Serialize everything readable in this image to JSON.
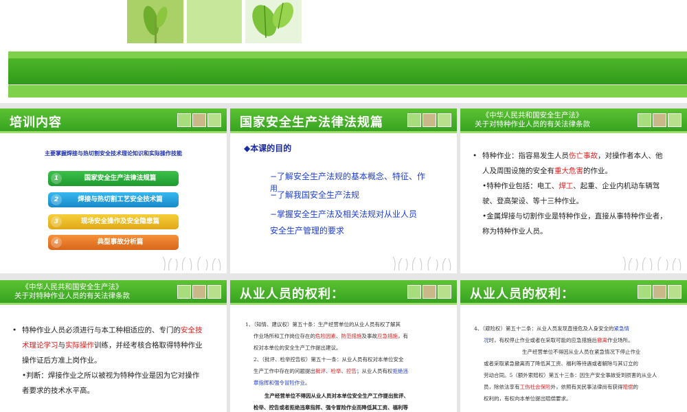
{
  "slides": {
    "s1": {
      "title": "培训内容",
      "subtitle": "主要掌握焊接与热切割安全技术理论知识和实际操作技能",
      "items": [
        {
          "num": "1",
          "label": "国家安全生产法律法规篇"
        },
        {
          "num": "2",
          "label": "焊接与热切割工艺安全技术篇"
        },
        {
          "num": "3",
          "label": "现场安全操作及安全隐患篇"
        },
        {
          "num": "4",
          "label": "典型事故分析篇"
        }
      ]
    },
    "s2": {
      "title": "国家安全生产法律法规篇",
      "purpose": "◆本课的目的",
      "line1": "−了解安全生产法规的基本概念、特征、作",
      "line1b": "用",
      "line2": "−了解我国安全生产法规",
      "line3": "−掌握安全生产法及相关法规对从业人员",
      "line3b": "安全生产管理的要求"
    },
    "s3": {
      "title_line1": "《中华人民共和国安全生产法》",
      "title_line2": "关于对特种作业人员的有关法律条款",
      "p1_a": "特种作业：指容易发生人员",
      "p1_red1": "伤亡事故",
      "p1_b": "，对操作者本人、他",
      "p1_c": "人及周围设施的安全有",
      "p1_red2": "重大危害",
      "p1_d": "的作业。",
      "p2_a": "•特种作业包括：电工、",
      "p2_red": "焊工",
      "p2_b": "、起重、企业内机动车辆驾",
      "p2_c": "驶、登高架设、等十三种作业。",
      "p3_a": "•金属焊接与切割作业是特种作业，直接从事特种作业者，",
      "p3_b": "称为特种作业人员。"
    },
    "s4": {
      "title_line1": "《中华人民共和国安全生产法》",
      "title_line2": "关于对特种作业人员的有关法律条款",
      "p1_a": "特种作业人员必须进行与本工种相适应的、专门的",
      "p1_red1": "安全技",
      "p1_red2": "术理论学习",
      "p1_b": "与",
      "p1_red3": "实际操作",
      "p1_c": "训练，并经考核合格取得特种作业",
      "p1_d": "操作证后方准上岗作业。",
      "p2_a": "•判断：焊接作业之所以被视为特种作业是因为它对操作",
      "p2_b": "者要求的技术水平高。"
    },
    "s5": {
      "title": "从业人员的权利：",
      "l1_a": "1、（知情、建议权）第五十条：生产经营单位的从业人员有权了解其",
      "l1_b": "作业场所和工作岗位存在的",
      "l1_red1": "危险因素",
      "l1_c": "、",
      "l1_red2": "防范措施",
      "l1_d": "及事故",
      "l1_red3": "应急措施",
      "l1_e": "，有",
      "l1_f": "权对本单位的安全生产工作提出建议。",
      "l2_a": "2、（批评、检举控告权）第五十一条：从业人员有权对本单位安全",
      "l2_b": "生产工作中存在的问题提出",
      "l2_red1": "批评",
      "l2_c": "、",
      "l2_red2": "检举",
      "l2_d": "、",
      "l2_red3": "控告",
      "l2_e": "；从业人员有权",
      "l2_blue": "拒绝违",
      "l2_f": "章指挥和强令冒险作业",
      "l2_g": "。",
      "b1": "生产经营单位不得因从业人员对本单位安全生产工作提出批评、",
      "b2": "检举、控告或者拒绝违章指挥、强令冒险作业而降低其工资、福利等"
    },
    "s6": {
      "title": "从业人员的权利：",
      "l1_a": "4、（避险权）第五十二条：从业人员发现直接危及人身安全的",
      "l1_blue": "紧急情",
      "l1_b": "况",
      "l1_c": "时，有权停止作业或者在采取可能的应急措施后",
      "l1_red": "撤离",
      "l1_d": "作业场所。",
      "l2": "生产经营单位不得因从业人员在紧急情况下停止作业",
      "l3": "或者采取紧急撤离而了降低其工资、福利等待遇或者解除与其订立的",
      "l4_a": "劳动合同。",
      "l4_b": "5（额外索赔权）第五十三条：因生产安全事故受到损害的从业人",
      "l5_a": "员，除依法享有",
      "l5_red": "工伤社会保险",
      "l5_b": "外，依照有关民事法律尚有获得",
      "l5_red2": "赔偿",
      "l5_c": "的",
      "l6": "权利的，有权向本单位提出赔偿要求。"
    }
  }
}
